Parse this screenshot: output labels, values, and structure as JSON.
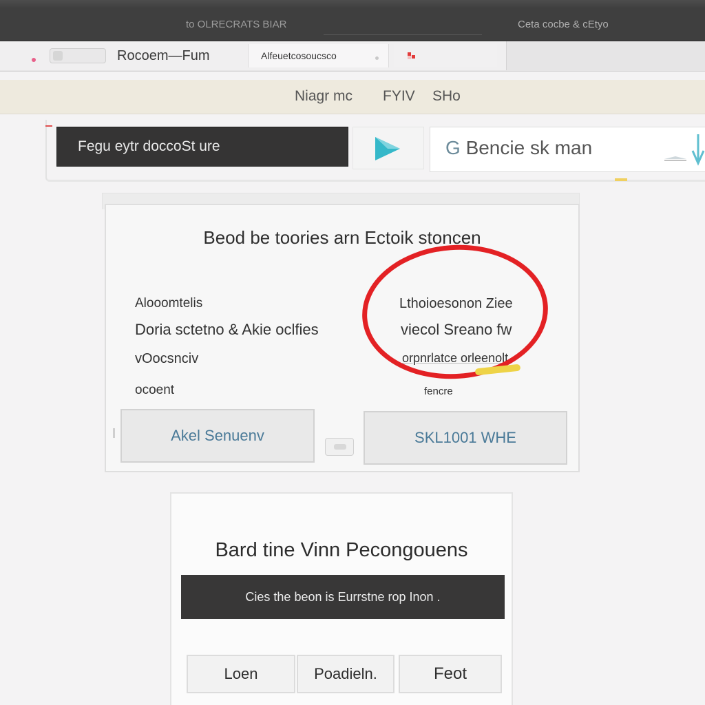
{
  "window": {
    "title": "to OLRECRATS BIAR",
    "title_right": "Ceta cocbe & cEtyo"
  },
  "tabs": {
    "tab1_label": "Rocoem—Fum",
    "tab2_label": "Alfeuetcosoucsco",
    "tab3_icon": "flag-icon"
  },
  "nav": {
    "items": [
      "Niagr mc",
      "FYIV",
      "SHo"
    ]
  },
  "search": {
    "dark_label": "Fegu eytr doccoSt ure",
    "play_icon": "play-icon",
    "input_prefix": "G",
    "input_value": "Bencie sk man"
  },
  "card": {
    "title": "Beod be toories arn Ectoik stoncen",
    "left": {
      "row1": "Alooomtelis",
      "row2": "Doria sctetno & Akie oclfies",
      "row3": "vOocsnciv",
      "row4": "ocoent"
    },
    "right": {
      "row1": "Lthoioesonon Ziee",
      "row2": "viecol Sreano fw",
      "row3": "orpnrlatce orleenolt",
      "row4": "fencre"
    },
    "button_left": "Akel Senuenv",
    "button_right": "SKL1001 WHE"
  },
  "panel": {
    "title": "Bard tine Vinn Pecongouens",
    "dark_bar_label": "Cies the beon is Eurrstne rop Inon .",
    "buttons": [
      "Loen",
      "Poadieln.",
      "Feot"
    ]
  },
  "colors": {
    "annotation_red": "#e32124",
    "annotation_yellow": "#eed347",
    "play_teal": "#35b8c9",
    "button_text_blue": "#4a7a98"
  }
}
